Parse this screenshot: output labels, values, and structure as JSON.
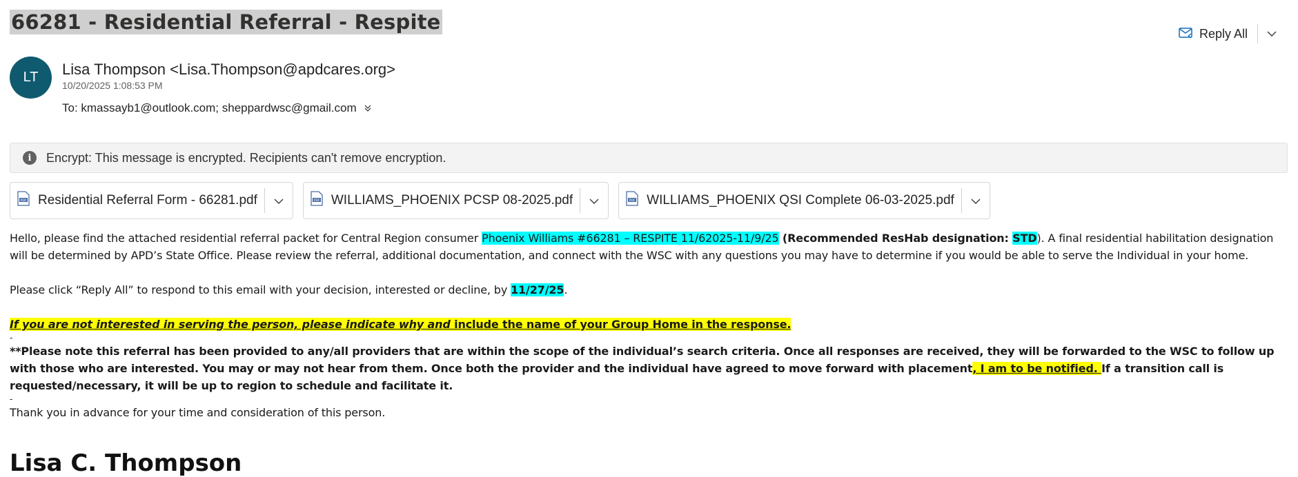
{
  "email": {
    "subject": "66281 - Residential Referral - Respite",
    "reply_all_label": "Reply All",
    "sender": {
      "initials": "LT",
      "display": "Lisa Thompson <Lisa.Thompson@apdcares.org>",
      "datetime": "10/20/2025 1:08:53 PM"
    },
    "to": "To: kmassayb1@outlook.com; sheppardwsc@gmail.com",
    "encrypt_notice": "Encrypt: This message is encrypted. Recipients can't remove encryption.",
    "attachments": [
      {
        "name": "Residential Referral Form - 66281.pdf",
        "icon": "pdf-icon"
      },
      {
        "name": "WILLIAMS_PHOENIX PCSP 08-2025.pdf",
        "icon": "pdf-icon"
      },
      {
        "name": "WILLIAMS_PHOENIX QSI Complete 06-03-2025.pdf",
        "icon": "pdf-icon"
      }
    ],
    "body": {
      "p1_a": "Hello, please find the attached residential referral packet for Central Region consumer ",
      "p1_hl": "Phoenix Williams #66281 – RESPITE 11/62025-11/9/25",
      "p1_b": " (Recommended ResHab designation: ",
      "p1_std": "STD",
      "p1_c": ").  A final residential habilitation designation will be determined by APD’s State Office.  Please review the referral, additional documentation, and connect with the WSC with any questions you may have to determine if you would be able to serve the Individual in your home.",
      "p2_a": "Please click “Reply All” to respond to this email with your decision, interested or decline, by ",
      "p2_date": "11/27/25",
      "p2_b": ".",
      "p3_italic": "If you are not interested in serving the person, please indicate why and",
      "p3_rest": " include the name of your Group Home in the response.",
      "dash": "-",
      "p4_a": "**Please note this referral has been provided to any/all providers that are within the scope of the individual’s search criteria. Once all responses are received, they will be forwarded to the WSC to follow up with those who are interested. You may or may not hear from them. Once both the provider and the individual have agreed to move forward with placement",
      "p4_hl": ", I am to be notified. ",
      "p4_b": "If a transition call is requested/necessary, it will be up to region to schedule and facilitate it.",
      "p5": "Thank you in advance for your time and consideration of this person.",
      "signature": "Lisa C. Thompson"
    },
    "colors": {
      "avatar": "#0f5a6e",
      "highlight_cyan": "#00ffff",
      "highlight_yellow": "#ffff00"
    }
  }
}
